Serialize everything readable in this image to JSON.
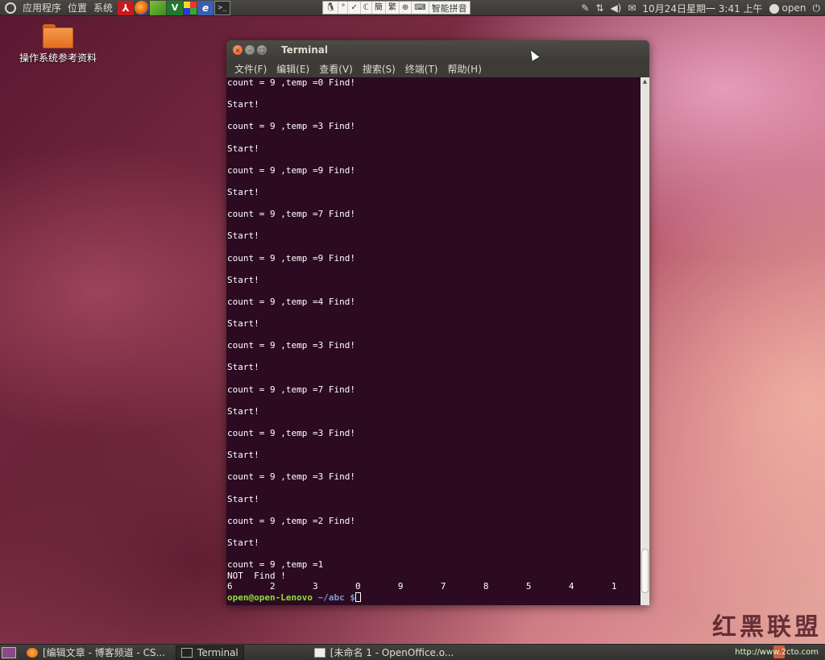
{
  "top_panel": {
    "menus": [
      "应用程序",
      "位置",
      "系统"
    ],
    "launchers": [
      "acrobat-icon",
      "firefox-icon",
      "app-icon",
      "vim-icon",
      "grid-icon",
      "eclipse-icon",
      "terminal-icon"
    ],
    "ime": {
      "cells": [
        "🐧",
        "°",
        "✓",
        "ℂ",
        "簡",
        "繁",
        "⊕",
        "⌨"
      ],
      "label": "智能拼音"
    },
    "tray": {
      "datetime": "10月24日星期一  3:41 上午",
      "user": "open"
    }
  },
  "desktop": {
    "folder_label": "操作系统参考资料"
  },
  "window": {
    "title": "Terminal",
    "menu": [
      "文件(F)",
      "编辑(E)",
      "查看(V)",
      "搜索(S)",
      "终端(T)",
      "帮助(H)"
    ],
    "lines": [
      "count = 9 ,temp =0 Find!",
      "",
      "Start!",
      "",
      "count = 9 ,temp =3 Find!",
      "",
      "Start!",
      "",
      "count = 9 ,temp =9 Find!",
      "",
      "Start!",
      "",
      "count = 9 ,temp =7 Find!",
      "",
      "Start!",
      "",
      "count = 9 ,temp =9 Find!",
      "",
      "Start!",
      "",
      "count = 9 ,temp =4 Find!",
      "",
      "Start!",
      "",
      "count = 9 ,temp =3 Find!",
      "",
      "Start!",
      "",
      "count = 9 ,temp =7 Find!",
      "",
      "Start!",
      "",
      "count = 9 ,temp =3 Find!",
      "",
      "Start!",
      "",
      "count = 9 ,temp =3 Find!",
      "",
      "Start!",
      "",
      "count = 9 ,temp =2 Find!",
      "",
      "Start!",
      "",
      "count = 9 ,temp =1",
      "NOT  Find !",
      "6       2       3       0       9       7       8       5       4       1"
    ],
    "prompt_user": "open@open-Lenovo",
    "prompt_path": "~/abc $"
  },
  "bottom_panel": {
    "tasks": [
      "[编辑文章 - 博客频道 - CS...",
      "Terminal",
      "[未命名 1 - OpenOffice.o..."
    ]
  },
  "watermark": {
    "text": "红黑联盟",
    "url": "http://www.2cto.com"
  }
}
